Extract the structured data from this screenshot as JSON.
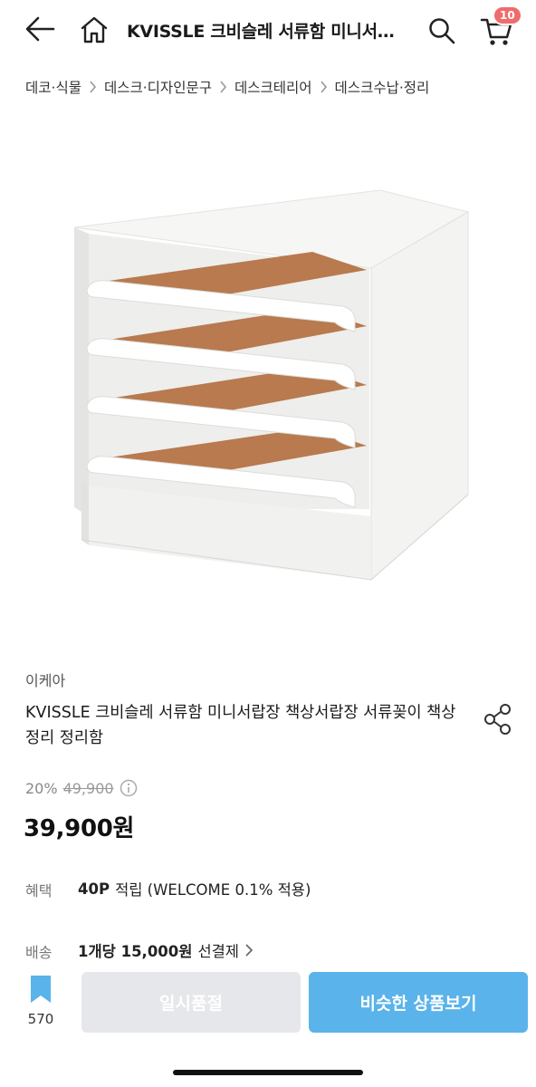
{
  "header": {
    "title": "KVISSLE 크비슬레 서류함 미니서랍장 책상서랍장",
    "cart_count": "10",
    "icons": {
      "back": "arrow-left-icon",
      "home": "home-icon",
      "search": "search-icon",
      "cart": "cart-icon"
    }
  },
  "breadcrumb": [
    "데코·식물",
    "데스크·디자인문구",
    "데스크테리어",
    "데스크수납·정리"
  ],
  "product": {
    "brand": "이케아",
    "title": "KVISSLE 크비슬레 서류함 미니서랍장 책상서랍장 서류꽂이 책상정리 정리함",
    "discount": "20%",
    "original_price": "49,900",
    "price": "39,900원"
  },
  "benefit": {
    "label": "혜택",
    "points": "40P",
    "text": "적립 (WELCOME 0.1% 적용)"
  },
  "shipping": {
    "label": "배송",
    "text": "1개당 15,000원",
    "method": "선결제"
  },
  "bottom": {
    "wish_count": "570",
    "soldout_label": "일시품절",
    "similar_label": "비슷한 상품보기"
  },
  "colors": {
    "accent": "#5ab3ea",
    "badge": "#ef6c6c",
    "disabled": "#e6e7ea"
  }
}
